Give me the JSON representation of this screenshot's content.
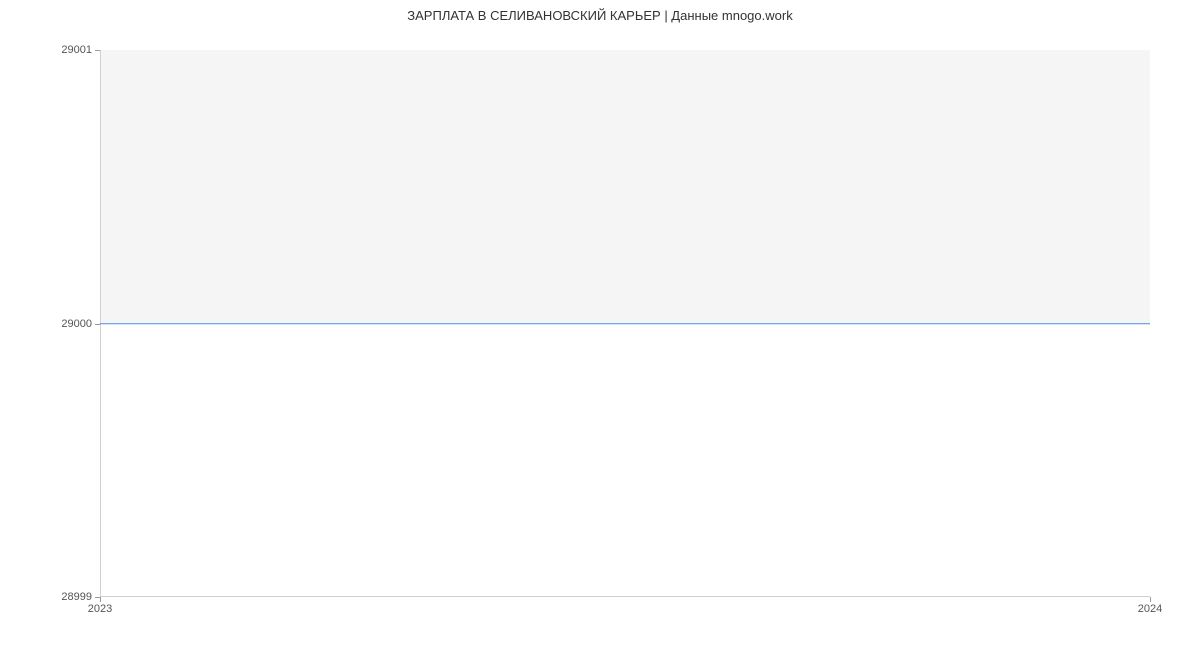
{
  "chart_data": {
    "type": "line",
    "title": "ЗАРПЛАТА В СЕЛИВАНОВСКИЙ КАРЬЕР | Данные mnogo.work",
    "x": [
      "2023",
      "2024"
    ],
    "values": [
      29000,
      29000
    ],
    "xlabel": "",
    "ylabel": "",
    "ylim": [
      28999,
      29001
    ],
    "y_ticks": [
      28999,
      29000,
      29001
    ],
    "x_ticks": [
      "2023",
      "2024"
    ]
  }
}
